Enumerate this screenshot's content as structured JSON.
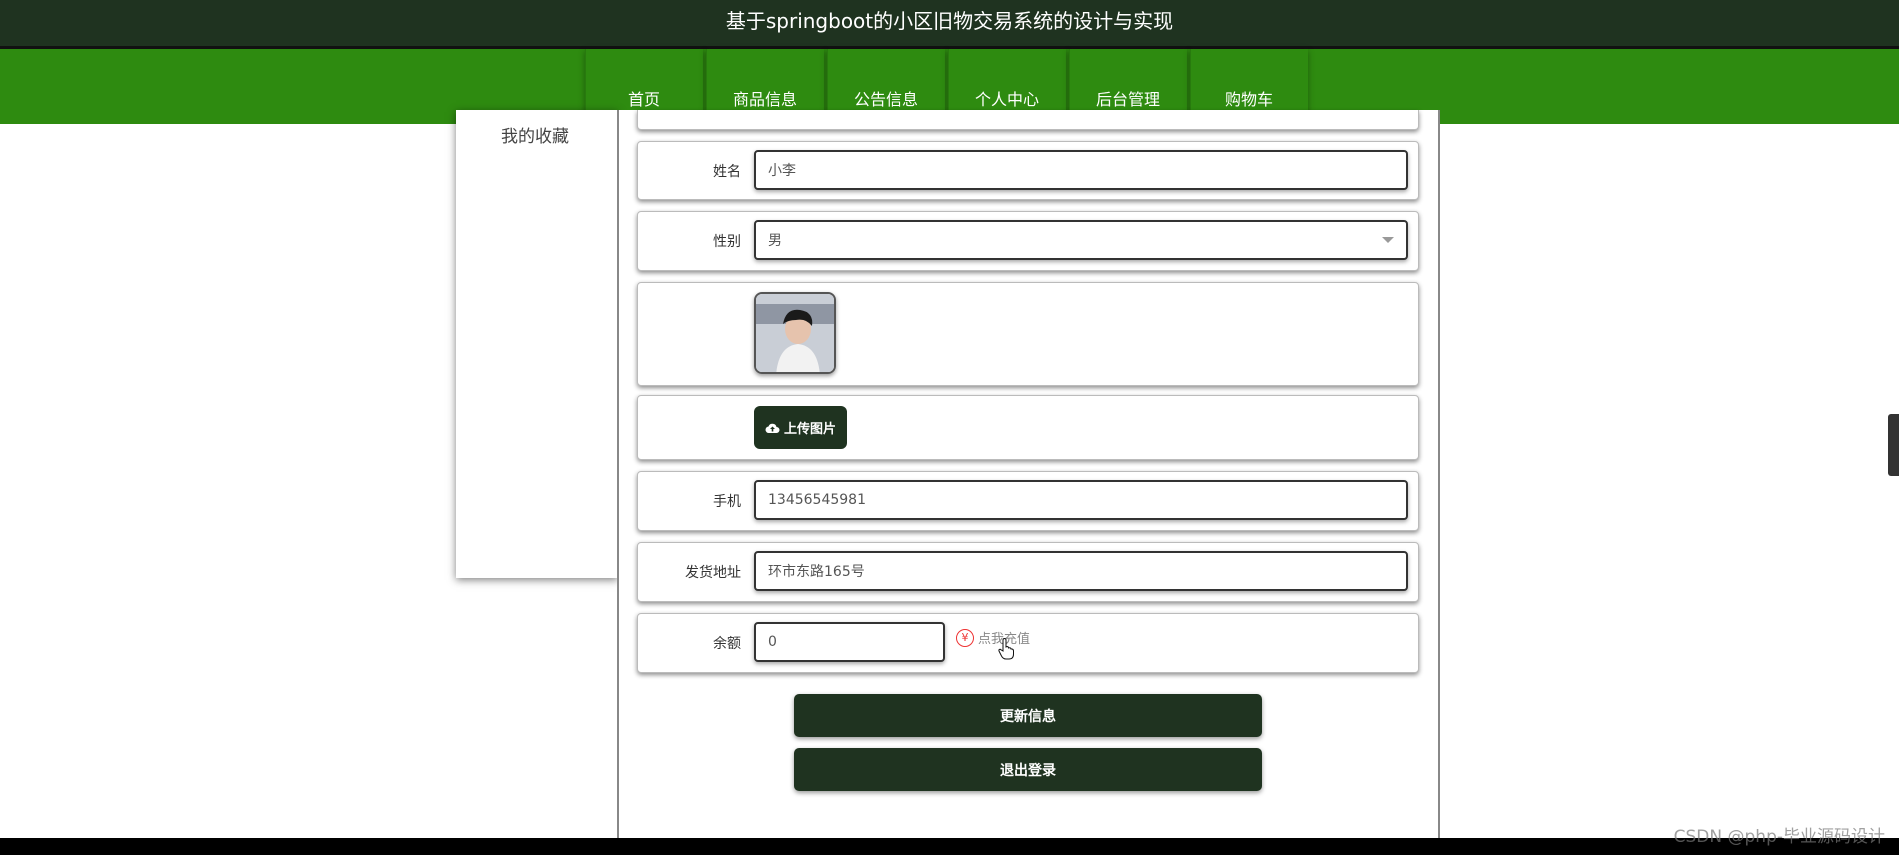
{
  "header": {
    "title": "基于springboot的小区旧物交易系统的设计与实现"
  },
  "nav": {
    "items": [
      {
        "label": "首页"
      },
      {
        "label": "商品信息"
      },
      {
        "label": "公告信息"
      },
      {
        "label": "个人中心"
      },
      {
        "label": "后台管理"
      },
      {
        "label": "购物车"
      }
    ]
  },
  "sidebar": {
    "favorites_label": "我的收藏"
  },
  "form": {
    "name_label": "姓名",
    "name_value": "小李",
    "gender_label": "性别",
    "gender_value": "男",
    "upload_label": "上传图片",
    "phone_label": "手机",
    "phone_value": "13456545981",
    "address_label": "发货地址",
    "address_value": "环市东路165号",
    "balance_label": "余额",
    "balance_value": "0",
    "recharge_label": "点我充值",
    "recharge_icon": "¥"
  },
  "actions": {
    "update_label": "更新信息",
    "logout_label": "退出登录"
  },
  "watermark": "CSDN @php-毕业源码设计",
  "colors": {
    "header_bg": "#1f3320",
    "nav_bg": "#2e8b10",
    "button_bg": "#1f3320"
  }
}
